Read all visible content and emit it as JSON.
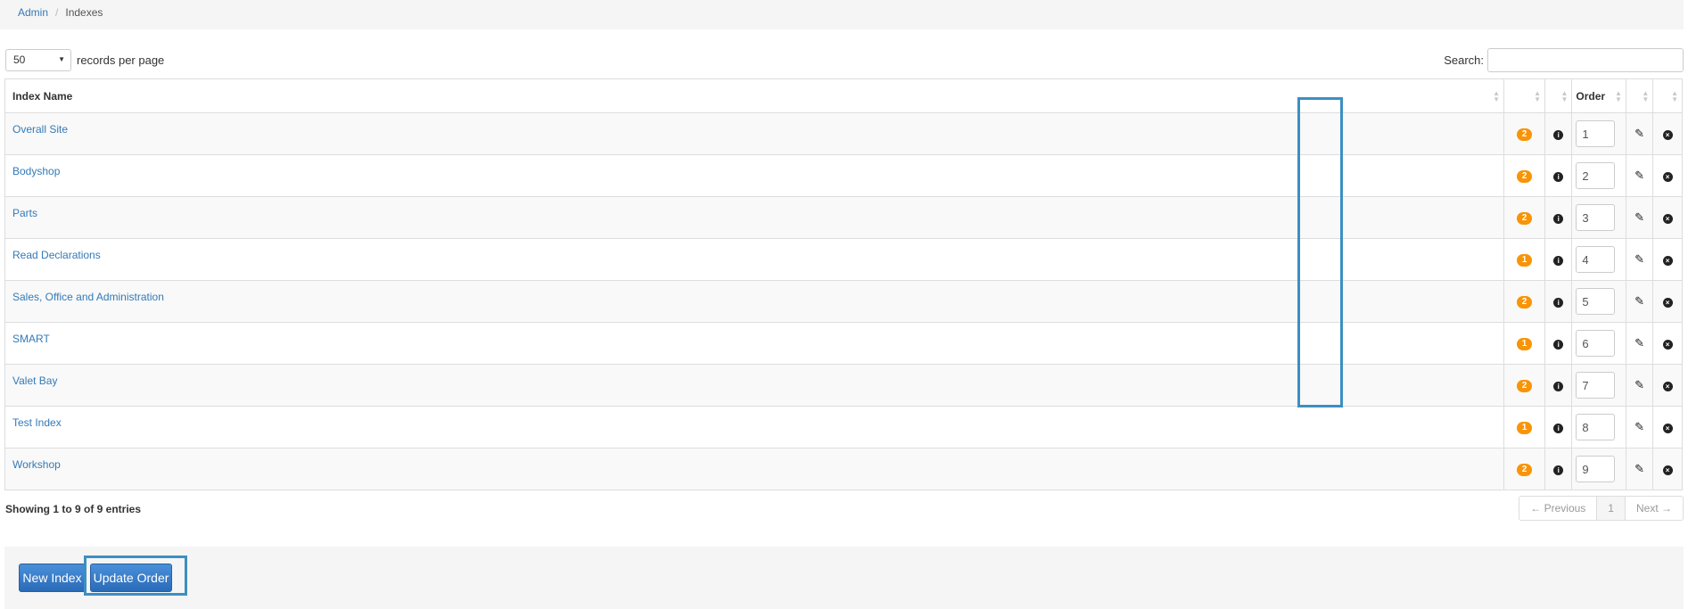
{
  "breadcrumb": {
    "admin": "Admin",
    "separator": "/",
    "current": "Indexes"
  },
  "length": {
    "value": "50",
    "label": "records per page"
  },
  "search": {
    "label": "Search:",
    "value": ""
  },
  "table": {
    "headers": {
      "name": "Index Name",
      "order": "Order"
    },
    "rows": [
      {
        "name": "Overall Site",
        "count": "2",
        "order": "1"
      },
      {
        "name": "Bodyshop",
        "count": "2",
        "order": "2"
      },
      {
        "name": "Parts",
        "count": "2",
        "order": "3"
      },
      {
        "name": "Read Declarations",
        "count": "1",
        "order": "4"
      },
      {
        "name": "Sales, Office and Administration",
        "count": "2",
        "order": "5"
      },
      {
        "name": "SMART",
        "count": "1",
        "order": "6"
      },
      {
        "name": "Valet Bay",
        "count": "2",
        "order": "7"
      },
      {
        "name": "Test Index",
        "count": "1",
        "order": "8"
      },
      {
        "name": "Workshop",
        "count": "2",
        "order": "9"
      }
    ]
  },
  "info": "Showing 1 to 9 of 9 entries",
  "pager": {
    "prev": "← Previous",
    "current": "1",
    "next": "Next →"
  },
  "buttons": {
    "new": "New Index",
    "update": "Update Order"
  },
  "icons": {
    "info": "info-circle-icon",
    "edit": "pencil-icon",
    "delete": "close-circle-icon"
  },
  "colors": {
    "link": "#337ab7",
    "badge": "#f89406",
    "highlight": "#3c8fc2",
    "button": "#2a6bb8"
  }
}
